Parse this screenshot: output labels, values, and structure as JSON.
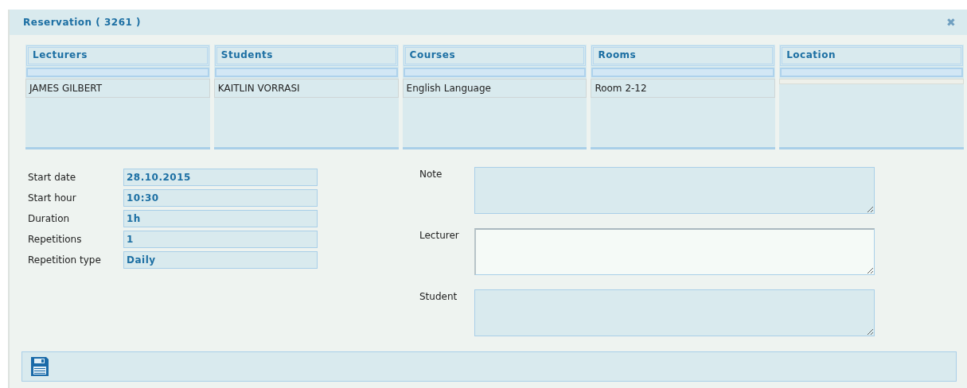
{
  "window": {
    "title": "Reservation ( 3261 )",
    "close": "✖"
  },
  "lists": [
    {
      "heading": "Lecturers",
      "rows": [
        "JAMES GILBERT"
      ]
    },
    {
      "heading": "Students",
      "rows": [
        "KAITLIN VORRASI"
      ]
    },
    {
      "heading": "Courses",
      "rows": [
        "English Language"
      ]
    },
    {
      "heading": "Rooms",
      "rows": [
        "Room 2-12"
      ]
    },
    {
      "heading": "Location"
    }
  ],
  "fields": [
    {
      "label": "Start date",
      "value": "28.10.2015"
    },
    {
      "label": "Start hour",
      "value": "10:30"
    },
    {
      "label": "Duration",
      "value": "1h"
    },
    {
      "label": "Repetitions",
      "value": "1"
    },
    {
      "label": "Repetition type",
      "value": "Daily"
    }
  ],
  "notes": [
    {
      "label": "Note",
      "focused": false
    },
    {
      "label": "Lecturer",
      "focused": true
    },
    {
      "label": "Student",
      "focused": false
    }
  ]
}
